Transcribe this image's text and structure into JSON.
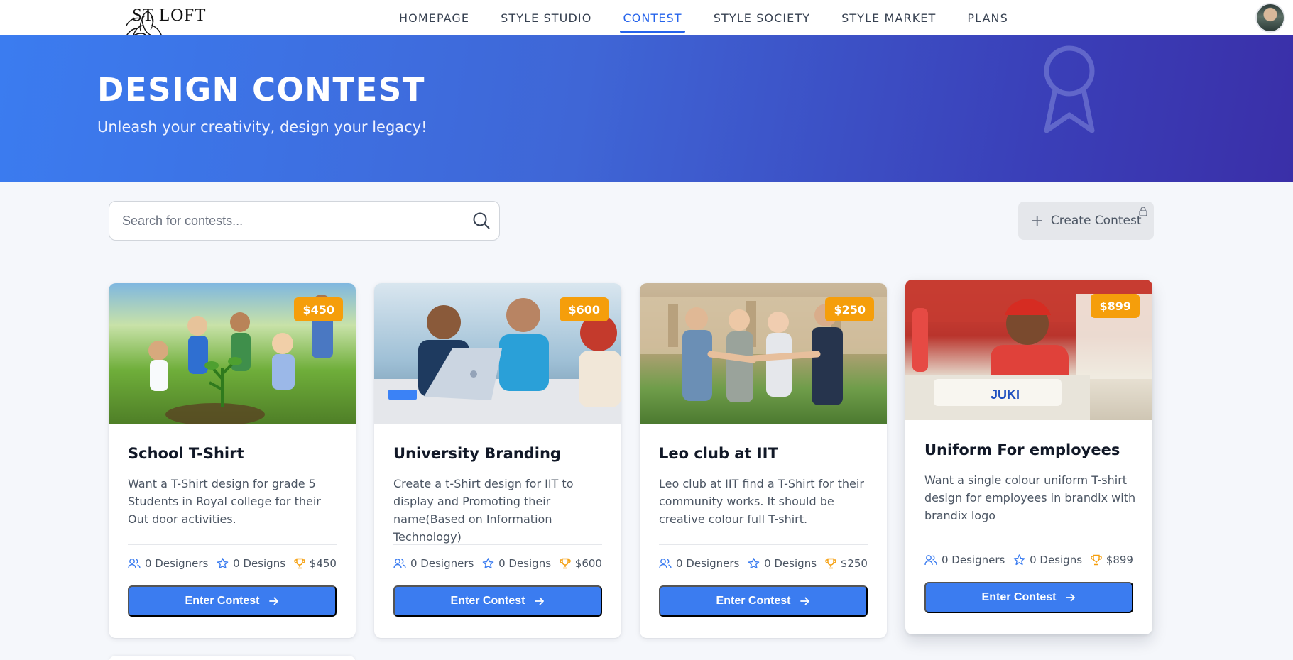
{
  "brand": {
    "logo_text": "ST LOFT"
  },
  "nav": {
    "items": [
      {
        "label": "HOMEPAGE"
      },
      {
        "label": "STYLE STUDIO"
      },
      {
        "label": "CONTEST"
      },
      {
        "label": "STYLE SOCIETY"
      },
      {
        "label": "STYLE MARKET"
      },
      {
        "label": "PLANS"
      }
    ],
    "active": "CONTEST"
  },
  "hero": {
    "title": "DESIGN CONTEST",
    "subtitle": "Unleash your creativity, design your legacy!",
    "icon": "award-ribbon-icon"
  },
  "toolbar": {
    "search_placeholder": "Search for contests...",
    "search_value": "",
    "create_label": "Create Contest"
  },
  "colors": {
    "accent": "#3b7cf0",
    "active_nav": "#2563eb",
    "prize": "#f59e0b",
    "hero_start": "#3b7cf0",
    "hero_end": "#3a2fa8"
  },
  "contests": [
    {
      "prize": "$450",
      "title": "School T-Shirt",
      "description": "Want a T-Shirt design for grade 5 Students in Royal college for their Out door activities.",
      "designers": "0 Designers",
      "designs": "0 Designs",
      "reward": "$450",
      "button": "Enter Contest"
    },
    {
      "prize": "$600",
      "title": "University Branding",
      "description": "Create a t-Shirt design for IIT to display and Promoting their name(Based on Information Technology)",
      "designers": "0 Designers",
      "designs": "0 Designs",
      "reward": "$600",
      "button": "Enter Contest"
    },
    {
      "prize": "$250",
      "title": "Leo club at IIT",
      "description": "Leo club at IIT find a T-Shirt for their community works. It should be creative colour full T-shirt.",
      "designers": "0 Designers",
      "designs": "0 Designs",
      "reward": "$250",
      "button": "Enter Contest"
    },
    {
      "prize": "$899",
      "title": "Uniform For employees",
      "description": "Want a single colour uniform T-shirt design for employees in brandix with brandix logo",
      "designers": "0 Designers",
      "designs": "0 Designs",
      "reward": "$899",
      "button": "Enter Contest"
    }
  ]
}
